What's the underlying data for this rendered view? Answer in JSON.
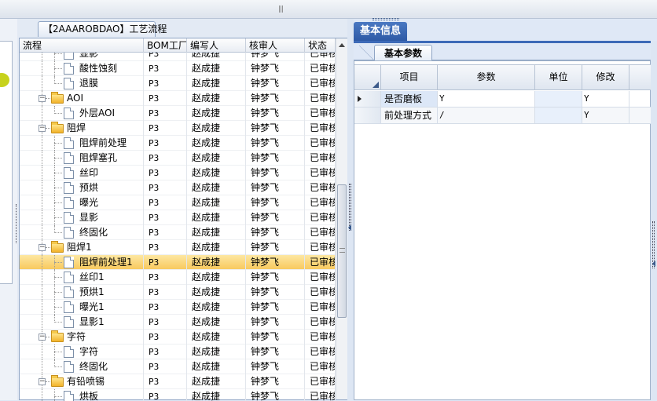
{
  "left_panel": {
    "tab_title": "【2AAAROBDAO】工艺流程",
    "columns": [
      "流程",
      "BOM工厂",
      "编写人",
      "核审人",
      "状态"
    ],
    "rows": [
      {
        "label": "显影",
        "type": "file",
        "level": 3,
        "factory": "P3",
        "author": "赵成捷",
        "reviewer": "钟梦飞",
        "status": "已审核"
      },
      {
        "label": "酸性蚀刻",
        "type": "file",
        "level": 3,
        "factory": "P3",
        "author": "赵成捷",
        "reviewer": "钟梦飞",
        "status": "已审核"
      },
      {
        "label": "退膜",
        "type": "file",
        "level": 3,
        "factory": "P3",
        "author": "赵成捷",
        "reviewer": "钟梦飞",
        "status": "已审核",
        "last": true
      },
      {
        "label": "AOI",
        "type": "folder",
        "level": 2,
        "factory": "P3",
        "author": "赵成捷",
        "reviewer": "钟梦飞",
        "status": "已审核"
      },
      {
        "label": "外层AOI",
        "type": "file",
        "level": 3,
        "factory": "P3",
        "author": "赵成捷",
        "reviewer": "钟梦飞",
        "status": "已审核",
        "last": true
      },
      {
        "label": "阻焊",
        "type": "folder",
        "level": 2,
        "factory": "P3",
        "author": "赵成捷",
        "reviewer": "钟梦飞",
        "status": "已审核"
      },
      {
        "label": "阻焊前处理",
        "type": "file",
        "level": 3,
        "factory": "P3",
        "author": "赵成捷",
        "reviewer": "钟梦飞",
        "status": "已审核"
      },
      {
        "label": "阻焊塞孔",
        "type": "file",
        "level": 3,
        "factory": "P3",
        "author": "赵成捷",
        "reviewer": "钟梦飞",
        "status": "已审核"
      },
      {
        "label": "丝印",
        "type": "file",
        "level": 3,
        "factory": "P3",
        "author": "赵成捷",
        "reviewer": "钟梦飞",
        "status": "已审核"
      },
      {
        "label": "预烘",
        "type": "file",
        "level": 3,
        "factory": "P3",
        "author": "赵成捷",
        "reviewer": "钟梦飞",
        "status": "已审核"
      },
      {
        "label": "曝光",
        "type": "file",
        "level": 3,
        "factory": "P3",
        "author": "赵成捷",
        "reviewer": "钟梦飞",
        "status": "已审核"
      },
      {
        "label": "显影",
        "type": "file",
        "level": 3,
        "factory": "P3",
        "author": "赵成捷",
        "reviewer": "钟梦飞",
        "status": "已审核"
      },
      {
        "label": "终固化",
        "type": "file",
        "level": 3,
        "factory": "P3",
        "author": "赵成捷",
        "reviewer": "钟梦飞",
        "status": "已审核",
        "last": true
      },
      {
        "label": "阻焊1",
        "type": "folder",
        "level": 2,
        "factory": "P3",
        "author": "赵成捷",
        "reviewer": "钟梦飞",
        "status": "已审核"
      },
      {
        "label": "阻焊前处理1",
        "type": "file",
        "level": 3,
        "factory": "P3",
        "author": "赵成捷",
        "reviewer": "钟梦飞",
        "status": "已审核",
        "selected": true
      },
      {
        "label": "丝印1",
        "type": "file",
        "level": 3,
        "factory": "P3",
        "author": "赵成捷",
        "reviewer": "钟梦飞",
        "status": "已审核"
      },
      {
        "label": "预烘1",
        "type": "file",
        "level": 3,
        "factory": "P3",
        "author": "赵成捷",
        "reviewer": "钟梦飞",
        "status": "已审核"
      },
      {
        "label": "曝光1",
        "type": "file",
        "level": 3,
        "factory": "P3",
        "author": "赵成捷",
        "reviewer": "钟梦飞",
        "status": "已审核"
      },
      {
        "label": "显影1",
        "type": "file",
        "level": 3,
        "factory": "P3",
        "author": "赵成捷",
        "reviewer": "钟梦飞",
        "status": "已审核",
        "last": true
      },
      {
        "label": "字符",
        "type": "folder",
        "level": 2,
        "factory": "P3",
        "author": "赵成捷",
        "reviewer": "钟梦飞",
        "status": "已审核"
      },
      {
        "label": "字符",
        "type": "file",
        "level": 3,
        "factory": "P3",
        "author": "赵成捷",
        "reviewer": "钟梦飞",
        "status": "已审核"
      },
      {
        "label": "终固化",
        "type": "file",
        "level": 3,
        "factory": "P3",
        "author": "赵成捷",
        "reviewer": "钟梦飞",
        "status": "已审核",
        "last": true
      },
      {
        "label": "有铅喷锡",
        "type": "folder",
        "level": 2,
        "factory": "P3",
        "author": "赵成捷",
        "reviewer": "钟梦飞",
        "status": "已审核"
      },
      {
        "label": "烘板",
        "type": "file",
        "level": 3,
        "factory": "P3",
        "author": "赵成捷",
        "reviewer": "钟梦飞",
        "status": "已审核"
      }
    ]
  },
  "right_panel": {
    "tab_title": "基本信息",
    "subtab_title": "基本参数",
    "columns": [
      "项目",
      "参数",
      "单位",
      "修改"
    ],
    "rows": [
      {
        "item": "是否磨板",
        "param": "Y",
        "unit": "",
        "modify": "Y",
        "current": true
      },
      {
        "item": "前处理方式",
        "param": "/",
        "unit": "",
        "modify": "Y"
      }
    ]
  },
  "topbar": {
    "grip": "|||"
  }
}
